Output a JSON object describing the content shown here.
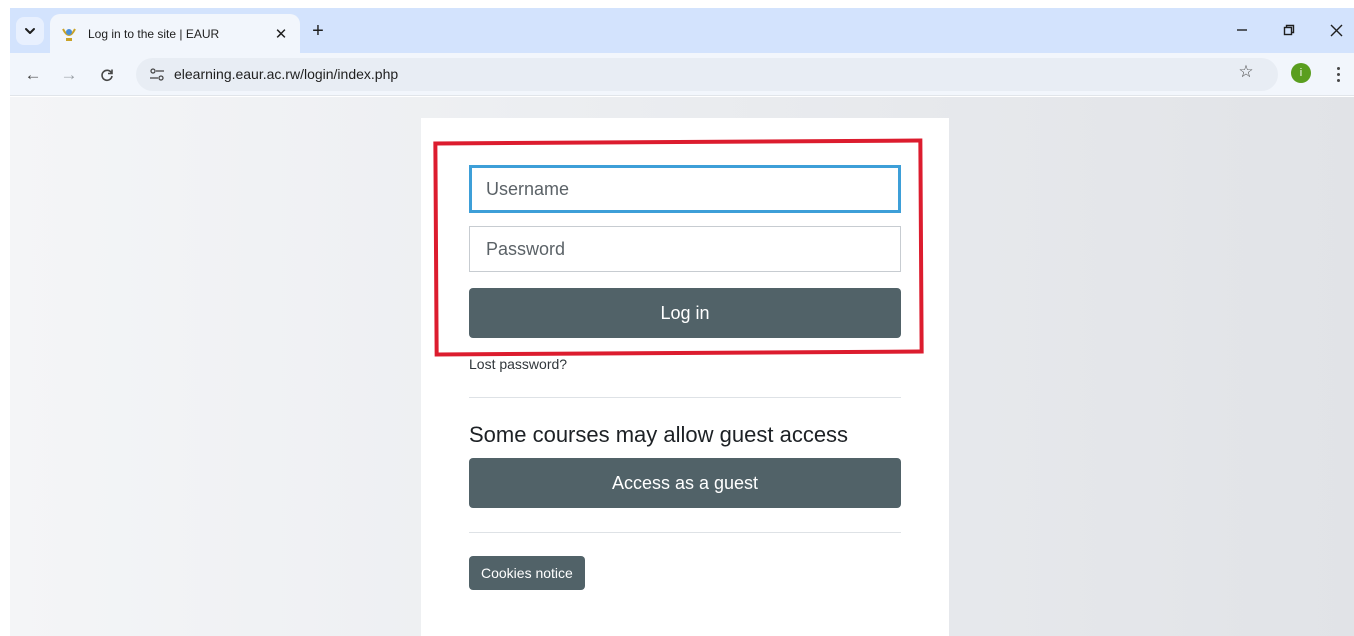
{
  "browser": {
    "tab": {
      "title": "Log in to the site | EAUR",
      "close_glyph": "✕"
    },
    "new_tab_glyph": "+",
    "window_controls": {
      "minimize": "–",
      "restore": "❐",
      "close": "✕"
    },
    "nav": {
      "back": "←",
      "forward": "→",
      "reload": "C"
    },
    "url": "elearning.eaur.ac.rw/login/index.php",
    "bookmark_glyph": "☆",
    "profile_initial": "i",
    "colors": {
      "tabstrip": "#d3e3fd",
      "toolbar": "#f2f6fc",
      "profile": "#5a9e1f"
    }
  },
  "login": {
    "username_placeholder": "Username",
    "password_placeholder": "Password",
    "login_button": "Log in",
    "lost_password": "Lost password?",
    "guest_heading": "Some courses may allow guest access",
    "guest_button": "Access as a guest",
    "cookies_button": "Cookies notice",
    "colors": {
      "button": "#516268",
      "focus_border": "#3d9fd8",
      "highlight": "#dc1c2e"
    }
  }
}
